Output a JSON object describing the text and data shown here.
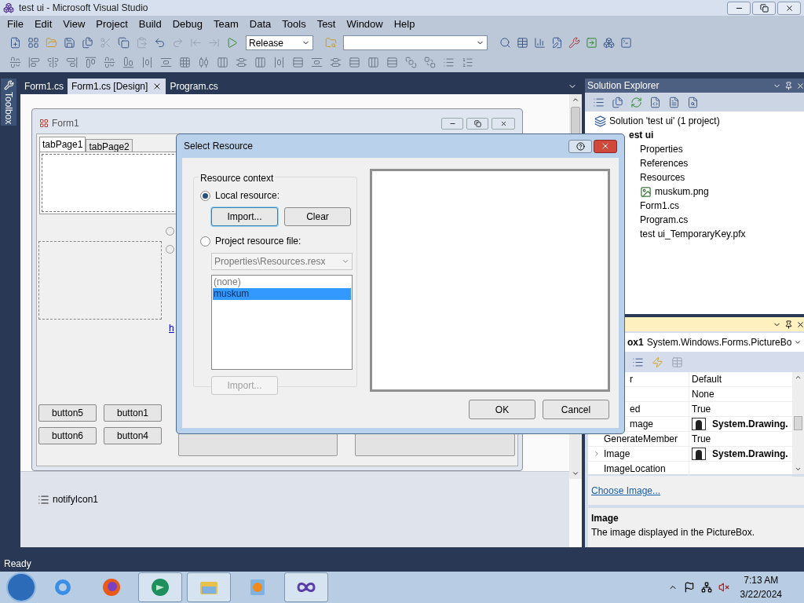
{
  "window": {
    "title": "test ui - Microsoft Visual Studio"
  },
  "menu": [
    "File",
    "Edit",
    "View",
    "Project",
    "Build",
    "Debug",
    "Team",
    "Data",
    "Tools",
    "Test",
    "Window",
    "Help"
  ],
  "toolbar": {
    "configuration": "Release"
  },
  "toolbox": {
    "label": "Toolbox"
  },
  "document_tabs": [
    {
      "label": "Form1.cs",
      "selected": false
    },
    {
      "label": "Form1.cs [Design]",
      "selected": true
    },
    {
      "label": "Program.cs",
      "selected": false
    }
  ],
  "designer": {
    "form_title": "Form1",
    "tabs": [
      {
        "label": "tabPage1",
        "selected": true
      },
      {
        "label": "tabPage2",
        "selected": false
      }
    ],
    "radios": [
      {
        "selected": false
      },
      {
        "selected": false
      }
    ],
    "link": "h",
    "buttons": [
      "button5",
      "button1",
      "button6",
      "button4"
    ],
    "tray": [
      "notifyIcon1"
    ]
  },
  "solution_explorer": {
    "title": "Solution Explorer",
    "tree": [
      {
        "label": "Solution 'test ui' (1 project)",
        "children": [
          {
            "label": "est ui",
            "children": [
              {
                "label": "Properties"
              },
              {
                "label": "References"
              },
              {
                "label": "Resources",
                "children": [
                  {
                    "label": "muskum.png"
                  }
                ]
              },
              {
                "label": "Form1.cs"
              },
              {
                "label": "Program.cs"
              },
              {
                "label": "test ui_TemporaryKey.pfx"
              }
            ]
          }
        ]
      }
    ]
  },
  "properties": {
    "object_name": "ox1",
    "object_type": "System.Windows.Forms.PictureBo",
    "rows": [
      {
        "name": "r",
        "value": "Default",
        "kind": "text"
      },
      {
        "value": "None",
        "kind": "text"
      },
      {
        "name": "ed",
        "value": "True",
        "kind": "text"
      },
      {
        "name": "mage",
        "value": "System.Drawing.",
        "kind": "image"
      },
      {
        "name": "GenerateMember",
        "value": "True",
        "kind": "text"
      },
      {
        "name": "Image",
        "value": "System.Drawing.",
        "kind": "image",
        "expandable": true
      },
      {
        "name": "ImageLocation",
        "kind": "text"
      }
    ],
    "command": "Choose Image...",
    "description_title": "Image",
    "description": "The image displayed in the PictureBox."
  },
  "dialog": {
    "title": "Select Resource",
    "group": "Resource context",
    "options": [
      {
        "label": "Local resource:",
        "selected": true
      },
      {
        "label": "Project resource file:",
        "selected": false
      }
    ],
    "local_buttons": [
      {
        "label": "Import...",
        "focused": true
      },
      {
        "label": "Clear",
        "focused": false
      }
    ],
    "resource_file": "Properties\\Resources.resx",
    "resources": [
      {
        "label": "(none)",
        "selected": false
      },
      {
        "label": "muskum",
        "selected": true
      }
    ],
    "project_import": {
      "label": "Import...",
      "disabled": true
    },
    "buttons": [
      "OK",
      "Cancel"
    ]
  },
  "status_bar": {
    "text": "Ready"
  },
  "clock": {
    "time": "7:13 AM",
    "date": "3/22/2024"
  }
}
